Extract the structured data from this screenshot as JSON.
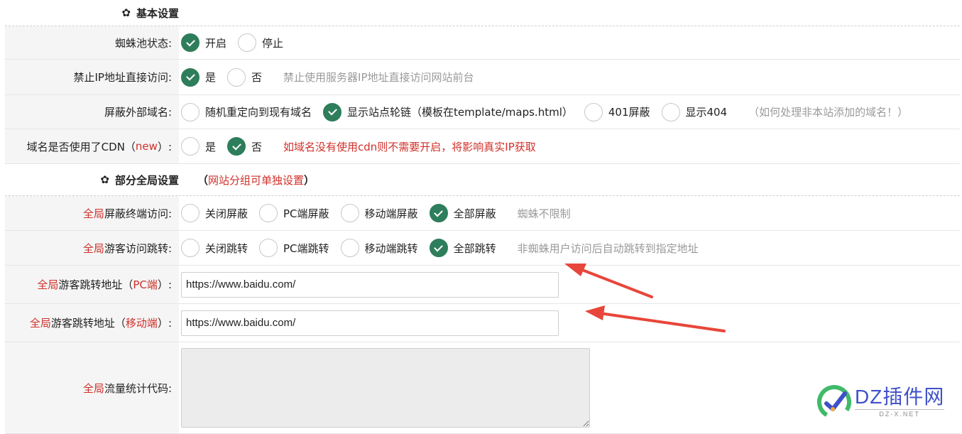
{
  "section1": {
    "title": "基本设置"
  },
  "rows": {
    "spider_status": {
      "label": "蜘蛛池状态:",
      "options": [
        "开启",
        "停止"
      ],
      "selected": 0
    },
    "ban_ip": {
      "label": "禁止IP地址直接访问:",
      "options": [
        "是",
        "否"
      ],
      "selected": 0,
      "hint": "禁止使用服务器IP地址直接访问网站前台"
    },
    "block_domain": {
      "label": "屏蔽外部域名:",
      "options": [
        "随机重定向到现有域名",
        "显示站点轮链（模板在template/maps.html）",
        "401屏蔽",
        "显示404"
      ],
      "selected": 1,
      "hint": "（如何处理非本站添加的域名！）"
    },
    "cdn": {
      "label_pre": "域名是否使用了CDN（",
      "label_red": "new",
      "label_post": "）:",
      "options": [
        "是",
        "否"
      ],
      "selected": 1,
      "hint": "如域名没有使用cdn则不需要开启，将影响真实IP获取"
    }
  },
  "section2": {
    "title": "部分全局设置",
    "note_pre": "（",
    "note_red": "网站分组可单独设置",
    "note_post": "）"
  },
  "global": {
    "prefix": "全局",
    "terminal": {
      "label": "屏蔽终端访问:",
      "options": [
        "关闭屏蔽",
        "PC端屏蔽",
        "移动端屏蔽",
        "全部屏蔽"
      ],
      "selected": 3,
      "hint": "蜘蛛不限制"
    },
    "redirect": {
      "label": "游客访问跳转:",
      "options": [
        "关闭跳转",
        "PC端跳转",
        "移动端跳转",
        "全部跳转"
      ],
      "selected": 3,
      "hint": "非蜘蛛用户访问后自动跳转到指定地址"
    },
    "pc_url": {
      "label_mid": "游客跳转地址（",
      "label_red": "PC端",
      "label_post": "）:",
      "value": "https://www.baidu.com/"
    },
    "mobile_url": {
      "label_mid": "游客跳转地址（",
      "label_red": "移动端",
      "label_post": "）:",
      "value": "https://www.baidu.com/"
    },
    "stats": {
      "label": "流量统计代码:",
      "value": ""
    }
  },
  "watermark": {
    "big": "DZ插件网",
    "small": "DZ-X.NET"
  },
  "colors": {
    "accent": "#2e7d5b",
    "red": "#d0302a",
    "hint": "#9a9a9a",
    "arrow": "#e8463a"
  }
}
